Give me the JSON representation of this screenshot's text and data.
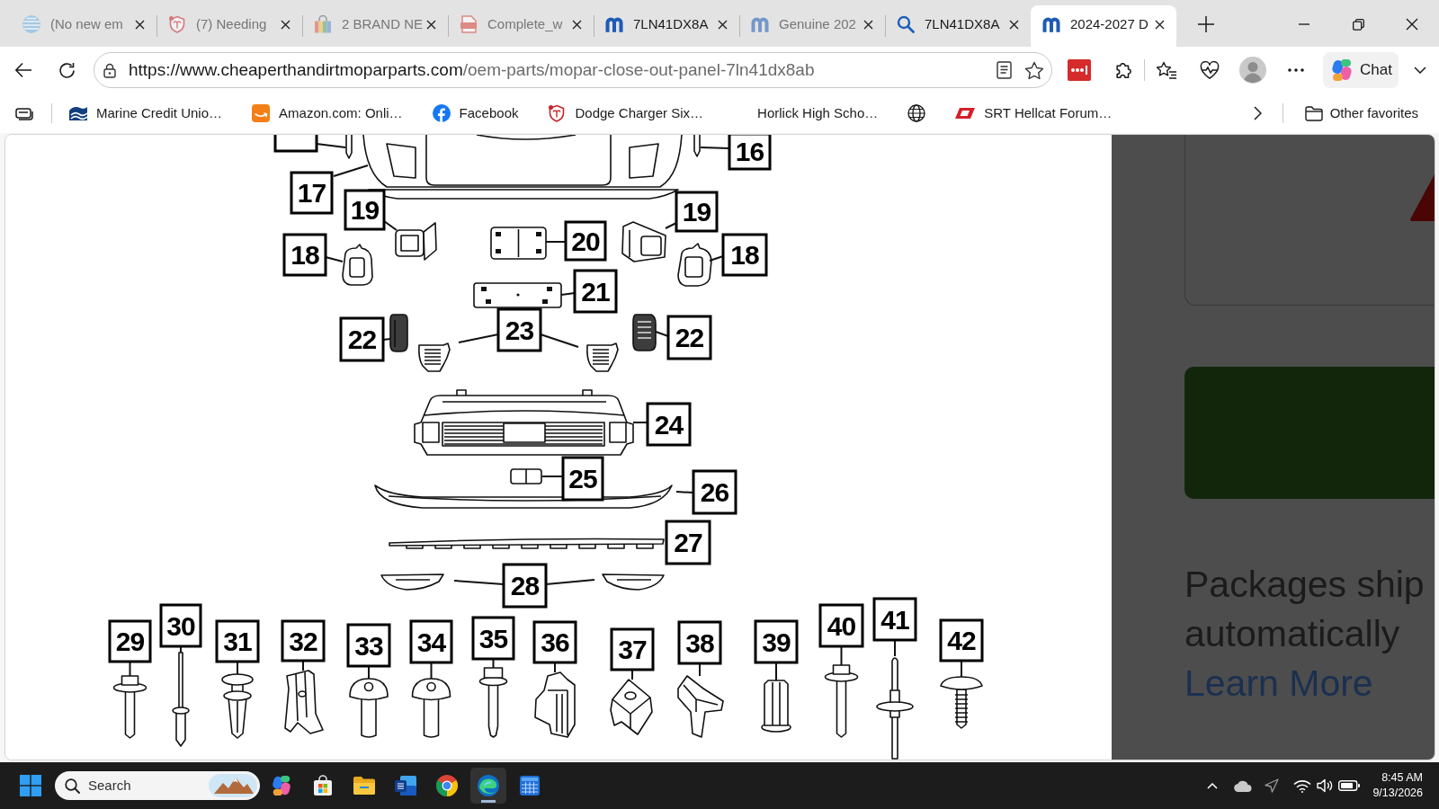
{
  "tabs": [
    {
      "title": "(No new em",
      "selected": false,
      "sleeping": true
    },
    {
      "title": "(7) Needing",
      "selected": false,
      "sleeping": true
    },
    {
      "title": "2 BRAND NE",
      "selected": false,
      "sleeping": true
    },
    {
      "title": "Complete_w",
      "selected": false,
      "sleeping": true
    },
    {
      "title": "7LN41DX8A",
      "selected": false,
      "sleeping": false
    },
    {
      "title": "Genuine 202",
      "selected": false,
      "sleeping": true
    },
    {
      "title": "7LN41DX8A",
      "selected": false,
      "sleeping": false
    },
    {
      "title": "2024-2027 D",
      "selected": true,
      "sleeping": false
    }
  ],
  "toolbar": {
    "url_host": "https://www.cheaperthandirtmoparparts.com",
    "url_path": "/oem-parts/mopar-close-out-panel-7ln41dx8ab",
    "chat_label": "Chat"
  },
  "bookmarks": {
    "items": [
      {
        "kind": "link",
        "label": "Marine Credit Unio…"
      },
      {
        "kind": "link",
        "label": "Amazon.com: Onli…"
      },
      {
        "kind": "link",
        "label": "Facebook"
      },
      {
        "kind": "link",
        "label": "Dodge Charger Six…"
      },
      {
        "kind": "link",
        "label": "Horlick High Scho…"
      },
      {
        "kind": "icon"
      },
      {
        "kind": "link",
        "label": "SRT Hellcat Forum…"
      }
    ],
    "other": "Other favorites"
  },
  "diagram": {
    "callouts": [
      "16",
      "17",
      "19",
      "19",
      "20",
      "18",
      "18",
      "21",
      "23",
      "22",
      "22",
      "24",
      "25",
      "26",
      "27",
      "28",
      "29",
      "30",
      "31",
      "32",
      "33",
      "34",
      "35",
      "36",
      "37",
      "38",
      "39",
      "40",
      "41",
      "42"
    ]
  },
  "side_panel": {
    "notice_lines": [
      "Packages ship",
      "automatically"
    ],
    "link": "Learn More"
  },
  "taskbar": {
    "search_label": "Search",
    "apps": [
      {
        "selected": false
      },
      {
        "selected": false
      },
      {
        "selected": false
      },
      {
        "selected": false
      },
      {
        "selected": false
      },
      {
        "selected": true
      },
      {
        "selected": false
      }
    ],
    "time": "8:45 AM",
    "date": "9/13/2026"
  }
}
